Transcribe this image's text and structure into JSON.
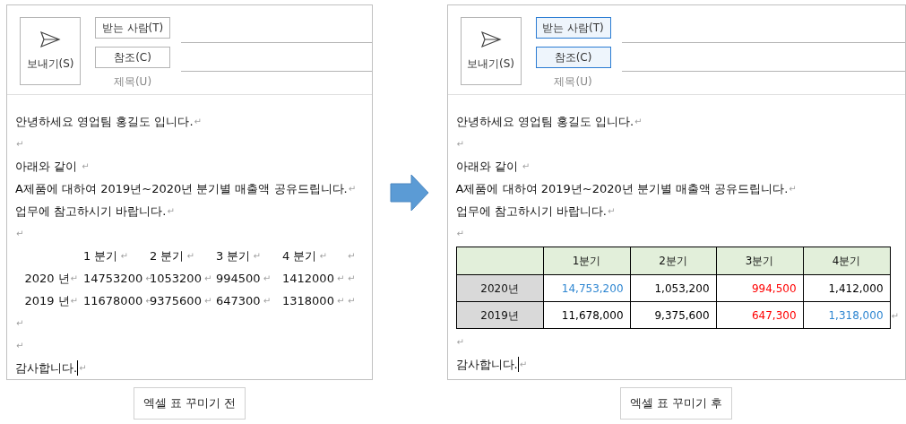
{
  "panels": [
    {
      "send_label": "보내기(S)",
      "to_button": "받는 사람(T)",
      "cc_button": "참조(C)",
      "subject_label": "제목(U)",
      "buttons_highlighted": false,
      "caption": "엑셀 표 꾸미기 전",
      "body": [
        {
          "kind": "paragraph",
          "text": "안녕하세요 영업팀 홍길도 입니다.",
          "mark": "↵"
        },
        {
          "kind": "paragraph",
          "mark": "↵"
        },
        {
          "kind": "paragraph",
          "text": "아래와 같이 ",
          "mark": "↵"
        },
        {
          "kind": "paragraph",
          "text": "A제품에 대하여 2019년~2020년 분기별 매출액 공유드립니다.",
          "mark": "↵"
        },
        {
          "kind": "paragraph",
          "text": "업무에 참고하시기 바랍니다.",
          "mark": "↵"
        },
        {
          "kind": "paragraph",
          "mark": "↵"
        },
        {
          "kind": "plain_table",
          "rows": [
            {
              "row_mark": "↵",
              "cells": [
                {},
                {
                  "text": "1 분기",
                  "mark": "↵"
                },
                {
                  "text": "2 분기",
                  "mark": "↵"
                },
                {
                  "text": "3 분기",
                  "mark": "↵"
                },
                {
                  "text": "4 분기",
                  "mark": "↵"
                }
              ]
            },
            {
              "row_mark": "↵",
              "cells": [
                {
                  "text": "2020 년",
                  "mark": "↵"
                },
                {
                  "text": "14753200",
                  "mark": "↵"
                },
                {
                  "text": "1053200",
                  "mark": "↵"
                },
                {
                  "text": "994500",
                  "mark": "↵"
                },
                {
                  "text": "1412000",
                  "mark": "↵"
                }
              ]
            },
            {
              "row_mark": "↵",
              "cells": [
                {
                  "text": "2019 년",
                  "mark": "↵"
                },
                {
                  "text": "11678000",
                  "mark": "↵"
                },
                {
                  "text": "9375600",
                  "mark": "↵"
                },
                {
                  "text": "647300",
                  "mark": "↵"
                },
                {
                  "text": "1318000",
                  "mark": "↵"
                }
              ]
            }
          ]
        },
        {
          "kind": "paragraph",
          "mark": "↵"
        },
        {
          "kind": "paragraph",
          "mark": "↵"
        },
        {
          "kind": "paragraph",
          "text": "감사합니다.",
          "mark": "↵",
          "cursor": true
        }
      ]
    },
    {
      "send_label": "보내기(S)",
      "to_button": "받는 사람(T)",
      "cc_button": "참조(C)",
      "subject_label": "제목(U)",
      "buttons_highlighted": true,
      "caption": "엑셀 표 꾸미기 후",
      "body": [
        {
          "kind": "paragraph",
          "text": "안녕하세요 영업팀 홍길도 입니다.",
          "mark": "↵"
        },
        {
          "kind": "paragraph",
          "mark": "↵"
        },
        {
          "kind": "paragraph",
          "text": "아래와 같이 ",
          "mark": "↵"
        },
        {
          "kind": "paragraph",
          "text": "A제품에 대하여 2019년~2020년 분기별 매출액 공유드립니다.",
          "mark": "↵"
        },
        {
          "kind": "paragraph",
          "text": "업무에 참고하시기 바랍니다.",
          "mark": "↵"
        },
        {
          "kind": "paragraph",
          "mark": "↵"
        },
        {
          "kind": "grid_table",
          "header": [
            "1분기",
            "2분기",
            "3분기",
            "4분기"
          ],
          "rows": [
            {
              "label": "2020년",
              "cells": [
                {
                  "text": "14,753,200",
                  "color": "#2e86d1"
                },
                {
                  "text": "1,053,200",
                  "color": "#000000"
                },
                {
                  "text": "994,500",
                  "color": "#ff0000"
                },
                {
                  "text": "1,412,000",
                  "color": "#000000"
                }
              ]
            },
            {
              "label": "2019년",
              "row_mark": "↵",
              "cells": [
                {
                  "text": "11,678,000",
                  "color": "#000000"
                },
                {
                  "text": "9,375,600",
                  "color": "#000000"
                },
                {
                  "text": "647,300",
                  "color": "#ff0000"
                },
                {
                  "text": "1,318,000",
                  "color": "#2e86d1"
                }
              ]
            }
          ]
        },
        {
          "kind": "paragraph",
          "mark": "↵"
        },
        {
          "kind": "paragraph",
          "text": "감사합니다.",
          "mark": "↵",
          "cursor": true
        }
      ]
    }
  ]
}
